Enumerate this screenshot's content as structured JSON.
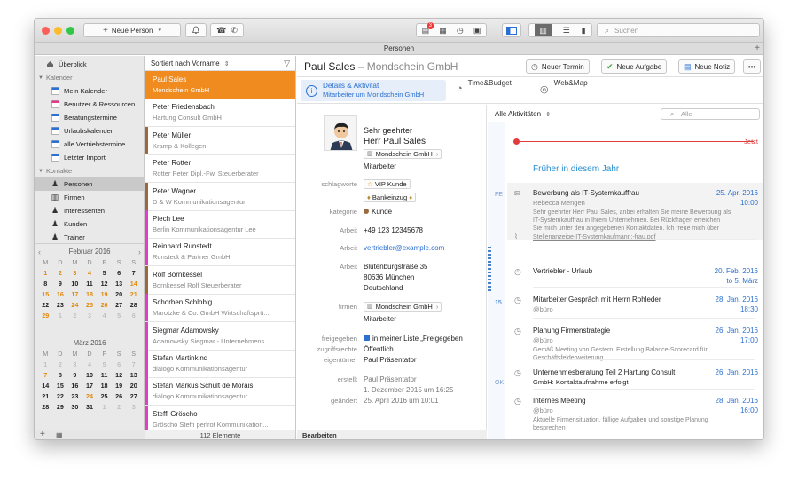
{
  "toolbar": {
    "new_person": "Neue Person",
    "notification_badge": "3",
    "search_placeholder": "Suchen"
  },
  "tab_title": "Personen",
  "sidebar": {
    "overview": "Überblick",
    "calendars_header": "Kalender",
    "calendars": [
      "Mein Kalender",
      "Benutzer & Ressourcen",
      "Beratungstermine",
      "Urlaubskalender",
      "alle Vertriebstermine",
      "Letzter Import"
    ],
    "contacts_header": "Kontakte",
    "contacts": [
      "Personen",
      "Firmen",
      "Interessenten",
      "Kunden",
      "Trainer"
    ]
  },
  "calendar_feb": {
    "title": "Februar 2016",
    "days_header": [
      "M",
      "D",
      "M",
      "D",
      "F",
      "S",
      "S"
    ],
    "rows": [
      [
        "1",
        "2",
        "3",
        "4",
        "5",
        "6",
        "7"
      ],
      [
        "8",
        "9",
        "10",
        "11",
        "12",
        "13",
        "14"
      ],
      [
        "15",
        "16",
        "17",
        "18",
        "19",
        "20",
        "21"
      ],
      [
        "22",
        "23",
        "24",
        "25",
        "26",
        "27",
        "28"
      ],
      [
        "29",
        "1",
        "2",
        "3",
        "4",
        "5",
        "6"
      ]
    ]
  },
  "calendar_mar": {
    "title": "März 2016",
    "days_header": [
      "M",
      "D",
      "M",
      "D",
      "F",
      "S",
      "S"
    ],
    "rows": [
      [
        "1",
        "2",
        "3",
        "4",
        "5",
        "6",
        "7"
      ],
      [
        "7",
        "8",
        "9",
        "10",
        "11",
        "12",
        "13"
      ],
      [
        "14",
        "15",
        "16",
        "17",
        "18",
        "19",
        "20"
      ],
      [
        "21",
        "22",
        "23",
        "24",
        "25",
        "26",
        "27"
      ],
      [
        "28",
        "29",
        "30",
        "31",
        "1",
        "2",
        "3"
      ]
    ]
  },
  "list": {
    "sort_label": "Sortiert nach Vorname",
    "count": "112 Elemente",
    "rows": [
      {
        "name": "Paul Sales",
        "company": "Mondschein GmbH",
        "color": "#ef8b1f"
      },
      {
        "name": "Peter Friedensbach",
        "company": "Hartung Consult GmbH",
        "color": "#ffffff"
      },
      {
        "name": "Peter Müller",
        "company": "Kramp & Kollegen",
        "color": "#9b6a3c"
      },
      {
        "name": "Peter Rotter",
        "company": "Rotter Peter Dipl.-Fw. Steuerberater",
        "color": "#ffffff"
      },
      {
        "name": "Peter Wagner",
        "company": "D & W Kommunikationsagentur",
        "color": "#9b6a3c"
      },
      {
        "name": "Piech Lee",
        "company": "Berlin Kommunikationsagentur Lee",
        "color": "#e040c8"
      },
      {
        "name": "Reinhard Runstedt",
        "company": "Runstedt & Partner GmbH",
        "color": "#e040c8"
      },
      {
        "name": "Rolf Bornkessel",
        "company": "Bornkessel Rolf Steuerberater",
        "color": "#9b6a3c"
      },
      {
        "name": "Schorben Schlobig",
        "company": "Marotzke & Co. GmbH Wirtschaftsprü...",
        "color": "#e040c8"
      },
      {
        "name": "Siegmar Adamowsky",
        "company": "Adamowsky Siegmar - Unternehmens...",
        "color": "#e040c8"
      },
      {
        "name": "Stefan Martinkind",
        "company": "diálogo Kommunikationsagentur",
        "color": "#e040c8"
      },
      {
        "name": "Stefan Markus Schult de Morais",
        "company": "diálogo Kommunikationsagentur",
        "color": "#e040c8"
      },
      {
        "name": "Steffi Gröscho",
        "company": "Gröscho Steffi perlrot Kommunikation...",
        "color": "#e040c8"
      }
    ]
  },
  "detail": {
    "name": "Paul Sales",
    "company_suffix": "– Mondschein GmbH",
    "actions": [
      "Neuer Termin",
      "Neue Aufgabe",
      "Neue Notiz"
    ],
    "tabs": {
      "details_title": "Details & Aktivität",
      "details_sub": "Mitarbeiter um Mondschein GmbH",
      "time_budget": "Time&Budget",
      "web_map": "Web&Map"
    },
    "salutation": "Sehr geehrter",
    "full_name": "Herr Paul Sales",
    "company": "Mondschein GmbH",
    "role": "Mitarbeiter",
    "labels": {
      "keywords": "schlagworte",
      "category": "kategorie",
      "work": "Arbeit",
      "companies": "firmen",
      "shared": "freigegeben",
      "access": "zugriffsrechte",
      "owner": "eigentümer",
      "created": "erstellt",
      "modified": "geändert",
      "editing": "Bearbeiten"
    },
    "tags": [
      "VIP Kunde",
      "Bankeinzug"
    ],
    "category": "Kunde",
    "phone": "+49 123 12345678",
    "email": "vertriebler@example.com",
    "street": "Blutenburgstraße 35",
    "city": "80636 München",
    "country": "Deutschland",
    "company2": "Mondschein GmbH",
    "role2": "Mitarbeiter",
    "shared_text": "in meiner Liste „Freigegeben",
    "access_text": "Öffentlich",
    "owner_text": "Paul Präsentator",
    "created_by": "Paul Präsentator",
    "created_date": "1. Dezember 2015 um 16:25",
    "modified_date": "25. April 2016 um 10:01"
  },
  "activities": {
    "filter": "Alle Aktivitäten",
    "search_placeholder": "Alle",
    "now_label": "Jetzt",
    "section_title": "Früher in diesem Jahr",
    "side_labels": [
      "FE",
      "15",
      "OK"
    ],
    "items": [
      {
        "title": "Bewerbung als IT-Systemkauffrau",
        "sub": "Rebecca Mengen",
        "date": "25. Apr. 2016",
        "time": "10:00",
        "body": [
          "Sehr geehrter Herr Paul Sales, anbei erhalten Sie meine Bewerbung als",
          "IT-Systemkauffrau in Ihrem Unternehmen. Bei Rückfragen erreichen",
          "Sie mich unter den angegebenen Kontaktdaten. Ich freue mich über"
        ],
        "attachment": "Stellenanzeige-IT-Systemkaufmann:-frau.pdf"
      },
      {
        "title": "Vertriebler - Urlaub",
        "date": "20. Feb. 2016",
        "time": "to 5. März",
        "color": "#2a6fd1"
      },
      {
        "title": "Mitarbeiter Gespräch mit Herrn Rohleder",
        "sub": "@büro",
        "date": "28. Jan. 2016",
        "time": "18:30",
        "color": "#2a6fd1"
      },
      {
        "title": "Planung Firmenstrategie",
        "sub": "@büro",
        "date": "26. Jan. 2016",
        "time": "17:00",
        "body": [
          "Gemäß Meeting von Gestern: Erstellung Balance-Scorecard für",
          "Geschäftsfelderweiterung"
        ],
        "color": "#2a6fd1"
      },
      {
        "title": "Unternehmesberatung Teil 2 Hartung Consult",
        "sub": "GmbH: Kontaktaufnahme erfolgt",
        "date": "26. Jan. 2016",
        "time": "",
        "color": "#3a9a3a"
      },
      {
        "title": "Internes Meeting",
        "sub": "@büro",
        "date": "28. Jan. 2016",
        "time": "16:00",
        "body": [
          "Aktuelle Firmensituation, fällige Aufgaben und sonstige Planung",
          "besprechen"
        ],
        "color": "#2a6fd1"
      }
    ]
  }
}
